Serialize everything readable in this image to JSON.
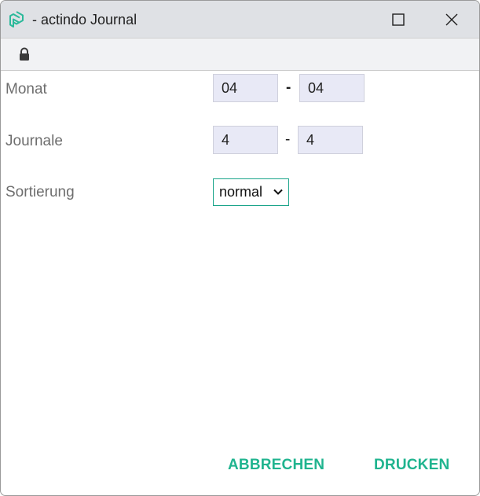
{
  "window": {
    "title": "- actindo Journal",
    "app_icon": "actindo-logo-icon",
    "maximize_icon": "maximize-icon",
    "close_icon": "close-icon"
  },
  "addressbar": {
    "lock_icon": "lock-icon"
  },
  "form": {
    "monat": {
      "label": "Monat",
      "from": "04",
      "separator": "-",
      "to": "04"
    },
    "journale": {
      "label": "Journale",
      "from": "4",
      "separator": "-",
      "to": "4"
    },
    "sortierung": {
      "label": "Sortierung",
      "selected": "normal"
    }
  },
  "actions": {
    "cancel_label": "ABBRECHEN",
    "print_label": "DRUCKEN"
  },
  "colors": {
    "accent": "#20b48f",
    "field_bg": "#e8e9f6",
    "titlebar_bg": "#dfe1e5"
  }
}
